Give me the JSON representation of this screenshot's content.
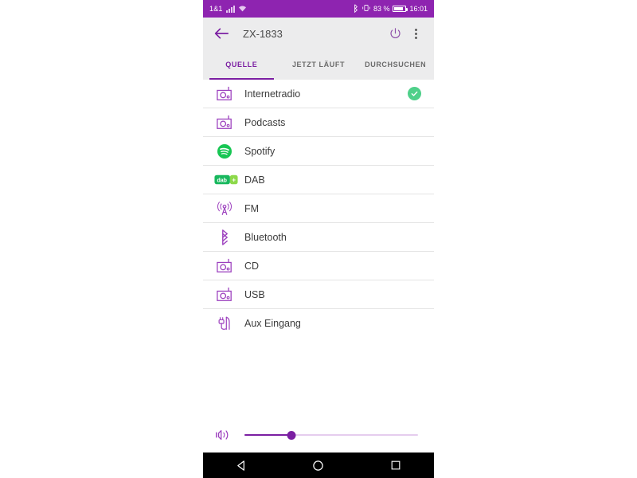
{
  "status_bar": {
    "carrier": "1&1",
    "signal_icon": "signal-bars-icon",
    "wifi_icon": "wifi-icon",
    "bluetooth_icon": "bluetooth-icon",
    "vibrate_icon": "vibrate-icon",
    "battery_percent": "83 %",
    "battery_icon": "battery-icon",
    "clock": "16:01",
    "background_color": "#8e24b0"
  },
  "app_bar": {
    "back_icon": "arrow-back-icon",
    "title": "ZX-1833",
    "power_icon": "power-icon",
    "overflow_icon": "more-vert-icon",
    "background_color": "#ececed"
  },
  "tabs": [
    {
      "label": "QUELLE",
      "active": true
    },
    {
      "label": "JETZT LÄUFT",
      "active": false
    },
    {
      "label": "DURCHSUCHEN",
      "active": false
    }
  ],
  "accent_color": "#7b1fa2",
  "sources": [
    {
      "label": "Internetradio",
      "icon": "radio-icon",
      "selected": true
    },
    {
      "label": "Podcasts",
      "icon": "radio-icon",
      "selected": false
    },
    {
      "label": "Spotify",
      "icon": "spotify-icon",
      "selected": false
    },
    {
      "label": "DAB",
      "icon": "dab-plus-icon",
      "selected": false
    },
    {
      "label": "FM",
      "icon": "antenna-icon",
      "selected": false
    },
    {
      "label": "Bluetooth",
      "icon": "bluetooth-icon",
      "selected": false
    },
    {
      "label": "CD",
      "icon": "radio-icon",
      "selected": false
    },
    {
      "label": "USB",
      "icon": "radio-icon",
      "selected": false
    },
    {
      "label": "Aux Eingang",
      "icon": "aux-plug-icon",
      "selected": false
    }
  ],
  "volume": {
    "icon": "volume-icon",
    "value_percent": 27,
    "track_color": "#e5cdee",
    "fill_color": "#7b1fa2"
  },
  "nav_bar": {
    "back_icon": "nav-back-triangle-icon",
    "home_icon": "nav-home-circle-icon",
    "recents_icon": "nav-recents-square-icon"
  },
  "dab_logo": {
    "text": "dab",
    "plus": "+"
  }
}
